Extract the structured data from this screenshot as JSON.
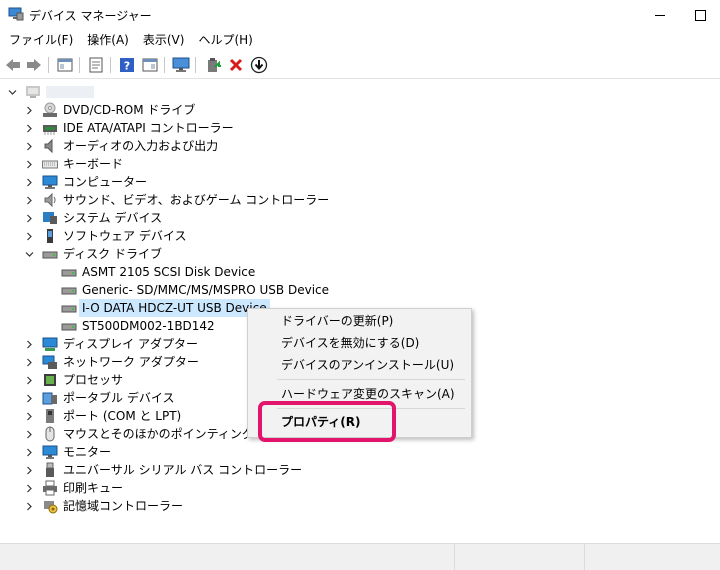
{
  "window": {
    "title": "デバイス マネージャー",
    "icon": "device-manager-icon"
  },
  "menu": [
    "ファイル(F)",
    "操作(A)",
    "表示(V)",
    "ヘルプ(H)"
  ],
  "toolbar": [
    "back-arrow-icon",
    "forward-arrow-icon",
    "show-hide-icon",
    "properties-icon",
    "help-icon",
    "action-view-icon",
    "monitor-icon",
    "update-driver-icon",
    "uninstall-icon",
    "download-icon"
  ],
  "tree": {
    "root": "",
    "categories": [
      {
        "label": "DVD/CD-ROM ドライブ",
        "icon": "dvd-drive-icon"
      },
      {
        "label": "IDE ATA/ATAPI コントローラー",
        "icon": "ide-controller-icon"
      },
      {
        "label": "オーディオの入力および出力",
        "icon": "speaker-icon"
      },
      {
        "label": "キーボード",
        "icon": "keyboard-icon"
      },
      {
        "label": "コンピューター",
        "icon": "computer-icon"
      },
      {
        "label": "サウンド、ビデオ、およびゲーム コントローラー",
        "icon": "sound-icon"
      },
      {
        "label": "システム デバイス",
        "icon": "system-device-icon"
      },
      {
        "label": "ソフトウェア デバイス",
        "icon": "software-device-icon"
      },
      {
        "label": "ディスク ドライブ",
        "icon": "disk-drive-icon"
      }
    ],
    "disk_children": [
      "ASMT 2105 SCSI Disk Device",
      "Generic- SD/MMC/MS/MSPRO USB Device",
      "I-O DATA HDCZ-UT USB Device",
      "ST500DM002-1BD142"
    ],
    "categories_after": [
      {
        "label": "ディスプレイ アダプター",
        "icon": "display-adapter-icon"
      },
      {
        "label": "ネットワーク アダプター",
        "icon": "network-adapter-icon"
      },
      {
        "label": "プロセッサ",
        "icon": "processor-icon"
      },
      {
        "label": "ポータブル デバイス",
        "icon": "portable-device-icon"
      },
      {
        "label": "ポート (COM と LPT)",
        "icon": "port-icon"
      },
      {
        "label": "マウスとそのほかのポインティング デバイス",
        "icon": "mouse-icon"
      },
      {
        "label": "モニター",
        "icon": "monitor-icon"
      },
      {
        "label": "ユニバーサル シリアル バス コントローラー",
        "icon": "usb-icon"
      },
      {
        "label": "印刷キュー",
        "icon": "printer-icon"
      },
      {
        "label": "記憶域コントローラー",
        "icon": "storage-controller-icon"
      }
    ]
  },
  "context_menu": {
    "items": [
      "ドライバーの更新(P)",
      "デバイスを無効にする(D)",
      "デバイスのアンインストール(U)",
      "ハードウェア変更のスキャン(A)",
      "プロパティ(R)"
    ]
  },
  "colors": {
    "selection": "#cce8ff",
    "highlight_border": "#e3146c"
  }
}
